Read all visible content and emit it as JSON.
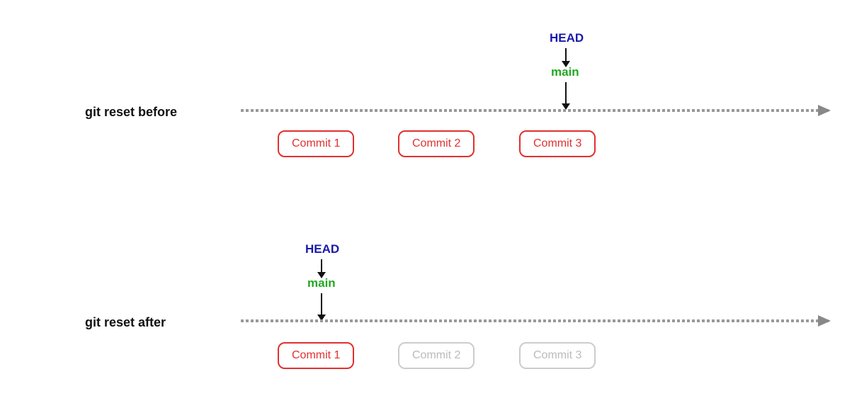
{
  "before": {
    "label": "git reset before",
    "head_text": "HEAD",
    "main_text": "main",
    "commits": [
      {
        "id": "c1-before",
        "text": "Commit 1",
        "style": "active"
      },
      {
        "id": "c2-before",
        "text": "Commit 2",
        "style": "active"
      },
      {
        "id": "c3-before",
        "text": "Commit 3",
        "style": "active"
      }
    ]
  },
  "after": {
    "label": "git reset after",
    "head_text": "HEAD",
    "main_text": "main",
    "commits": [
      {
        "id": "c1-after",
        "text": "Commit 1",
        "style": "active"
      },
      {
        "id": "c2-after",
        "text": "Commit 2",
        "style": "faded"
      },
      {
        "id": "c3-after",
        "text": "Commit 3",
        "style": "faded"
      }
    ]
  }
}
